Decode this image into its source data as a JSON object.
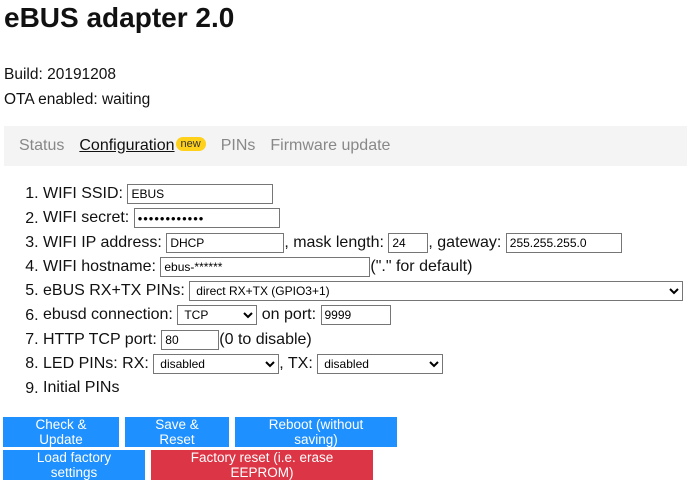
{
  "title": "eBUS adapter 2.0",
  "build": "Build: 20191208",
  "ota": "OTA enabled: waiting",
  "tabs": [
    {
      "label": "Status"
    },
    {
      "label": "Configuration",
      "badge": "new"
    },
    {
      "label": "PINs"
    },
    {
      "label": "Firmware update"
    }
  ],
  "form": {
    "wifi_ssid": {
      "label": "WIFI SSID:",
      "value": "EBUS"
    },
    "wifi_secret": {
      "label": "WIFI secret:",
      "value": "************"
    },
    "wifi_ip": {
      "label": "WIFI IP address:",
      "value": "DHCP",
      "mask_label": ", mask length:",
      "mask_value": "24",
      "gateway_label": ", gateway:",
      "gateway_value": "255.255.255.0"
    },
    "wifi_hostname": {
      "label": "WIFI hostname:",
      "value": "ebus-******",
      "suffix": "(\".\" for default)"
    },
    "ebus_pins": {
      "label": "eBUS RX+TX PINs:",
      "selected": "direct RX+TX (GPIO3+1)"
    },
    "ebusd_conn": {
      "label": "ebusd connection:",
      "selected": "TCP",
      "port_label": "on port:",
      "port_value": "9999"
    },
    "http_port": {
      "label": "HTTP TCP port:",
      "value": "80",
      "suffix": "(0 to disable)"
    },
    "led_pins": {
      "label": "LED PINs: RX:",
      "rx_selected": "disabled",
      "tx_label": ", TX:",
      "tx_selected": "disabled"
    },
    "initial_pins": {
      "label": "Initial PINs"
    }
  },
  "buttons": {
    "check_update": "Check & Update",
    "save_reset": "Save & Reset",
    "reboot": "Reboot (without saving)",
    "load_factory": "Load factory settings",
    "factory_reset": "Factory reset (i.e. erase EEPROM)"
  },
  "colors": {
    "primary": "#1e90ff",
    "danger": "#dc3545",
    "badge": "#ffd11a",
    "tabbar": "#f4f4f4"
  }
}
